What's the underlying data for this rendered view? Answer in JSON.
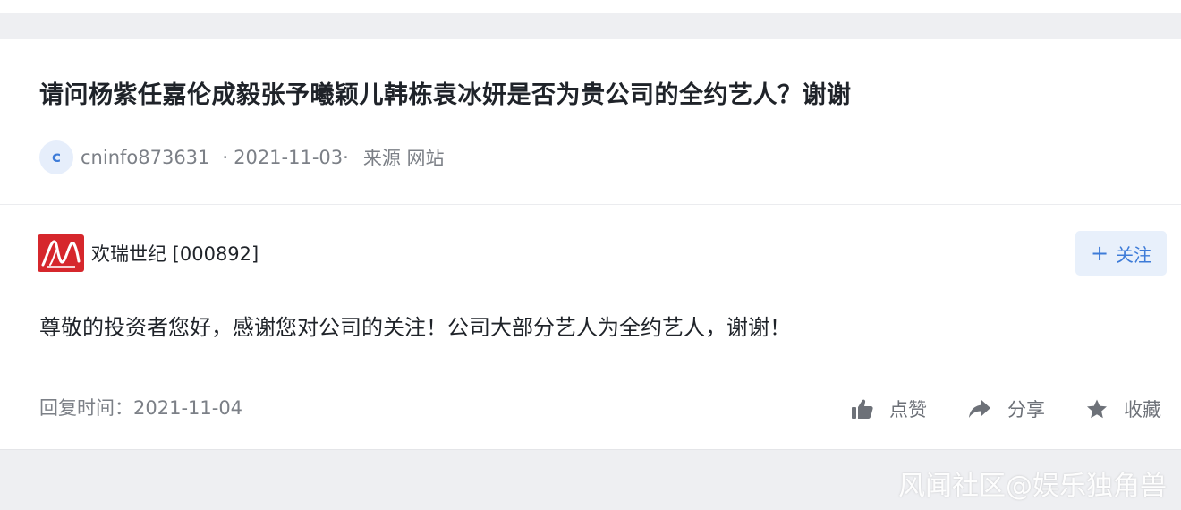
{
  "question": {
    "title": "请问杨紫任嘉伦成毅张予曦颖儿韩栋袁冰妍是否为贵公司的全约艺人？谢谢",
    "avatar_letter": "c",
    "user": "cninfo873631",
    "date_sep_before": "·",
    "date": "2021-11-03",
    "date_sep_after": "·",
    "source": "来源 网站"
  },
  "answer": {
    "company": "欢瑞世纪 [000892]",
    "follow_label": "关注",
    "follow_plus": "+",
    "text": "尊敬的投资者您好，感谢您对公司的关注！公司大部分艺人为全约艺人，谢谢！",
    "reply_time": "回复时间：2021-11-04",
    "actions": {
      "like": "点赞",
      "share": "分享",
      "favorite": "收藏"
    },
    "colors": {
      "accent": "#3d7bd8",
      "logo_red": "#d6272c"
    }
  },
  "watermark": "风闻社区@娱乐独角兽"
}
